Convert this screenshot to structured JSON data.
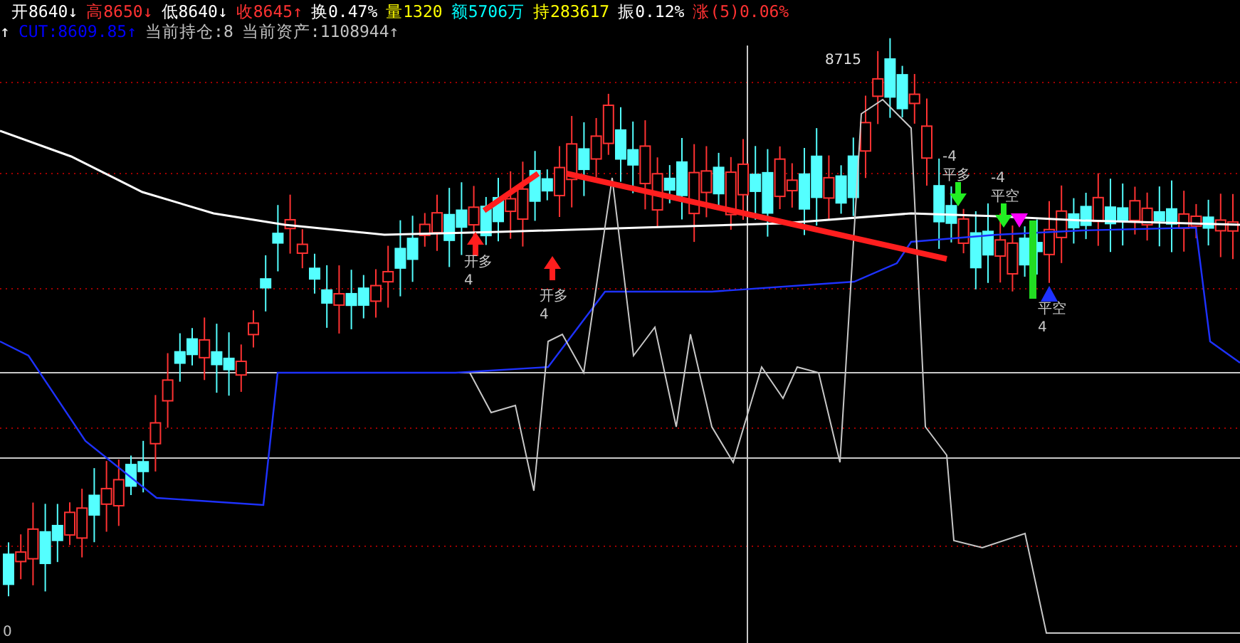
{
  "quote_bar": [
    {
      "text": "开8640↓",
      "color": "#ffffff"
    },
    {
      "text": "高8650↓",
      "color": "#ff3232"
    },
    {
      "text": "低8640↓",
      "color": "#ffffff"
    },
    {
      "text": "收8645↑",
      "color": "#ff3232"
    },
    {
      "text": "换0.47%",
      "color": "#ffffff"
    },
    {
      "text": "量1320",
      "color": "#ffff00"
    },
    {
      "text": "额5706万",
      "color": "#00ffff"
    },
    {
      "text": "持283617",
      "color": "#ffff00"
    },
    {
      "text": "振0.12%",
      "color": "#ffffff"
    },
    {
      "text": "涨(5)0.06%",
      "color": "#ff3232"
    }
  ],
  "indicator_bar": [
    {
      "text": "↑",
      "color": "#ffffff"
    },
    {
      "text": "CUT:8609.85↑",
      "color": "#0000ff"
    },
    {
      "text": "当前持仓:8",
      "color": "#c0c0c0"
    },
    {
      "text": "当前资产:1108944↑",
      "color": "#c0c0c0"
    }
  ],
  "chart": {
    "high_label": "8715",
    "bottom_label": "0",
    "signals": [
      {
        "kind": "buy",
        "lines": [
          "开多",
          "4"
        ]
      },
      {
        "kind": "buy",
        "lines": [
          "开多",
          "4"
        ]
      },
      {
        "kind": "close_long",
        "lines": [
          "-4",
          "平多"
        ]
      },
      {
        "kind": "close_short",
        "lines": [
          "-4",
          "平空"
        ]
      },
      {
        "kind": "cover",
        "lines": [
          "平空",
          "4"
        ]
      }
    ]
  }
}
